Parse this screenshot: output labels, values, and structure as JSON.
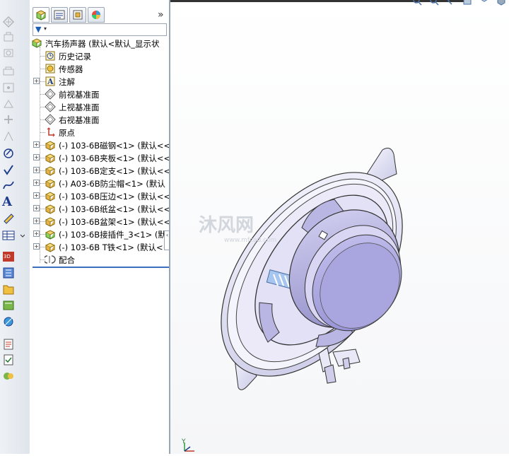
{
  "feature_manager": {
    "filter_icon": "filter-icon",
    "expand_label": "»",
    "tree": {
      "root": "汽车扬声器 (默认<默认_显示状",
      "items": [
        {
          "label": "历史记录",
          "icon": "history-icon",
          "expandable": false
        },
        {
          "label": "传感器",
          "icon": "sensor-icon",
          "expandable": false
        },
        {
          "label": "注解",
          "icon": "annotation-icon",
          "expandable": true
        },
        {
          "label": "前视基准面",
          "icon": "plane-icon",
          "expandable": false
        },
        {
          "label": "上视基准面",
          "icon": "plane-icon",
          "expandable": false
        },
        {
          "label": "右视基准面",
          "icon": "plane-icon",
          "expandable": false
        },
        {
          "label": "原点",
          "icon": "origin-icon",
          "expandable": false
        },
        {
          "label": "(-) 103-6B磁钢<1> (默认<<",
          "icon": "part-icon",
          "expandable": true
        },
        {
          "label": "(-) 103-6B夹板<1> (默认<<",
          "icon": "part-icon",
          "expandable": true
        },
        {
          "label": "(-) 103-6B定支<1> (默认<<",
          "icon": "part-icon",
          "expandable": true
        },
        {
          "label": "(-) A03-6B防尘帽<1> (默认",
          "icon": "part-icon",
          "expandable": true
        },
        {
          "label": "(-) 103-6B压边<1> (默认<<",
          "icon": "part-icon",
          "expandable": true
        },
        {
          "label": "(-) 103-6B纸盆<1> (默认<<",
          "icon": "part-icon",
          "expandable": true
        },
        {
          "label": "(-) 103-6B盆架<1> (默认<<",
          "icon": "part-icon",
          "expandable": true
        },
        {
          "label": "(-) 103-6B接插件_3<1> (默",
          "icon": "subassembly-icon",
          "expandable": true
        },
        {
          "label": "(-) 103-6B T铁<1> (默认<<",
          "icon": "part-icon",
          "expandable": true
        },
        {
          "label": "配合",
          "icon": "mates-icon",
          "expandable": false
        }
      ]
    }
  },
  "graphics": {
    "watermark_text": "沐风网",
    "watermark_sub": "www.mfcad.com",
    "triad_label": "Y"
  }
}
